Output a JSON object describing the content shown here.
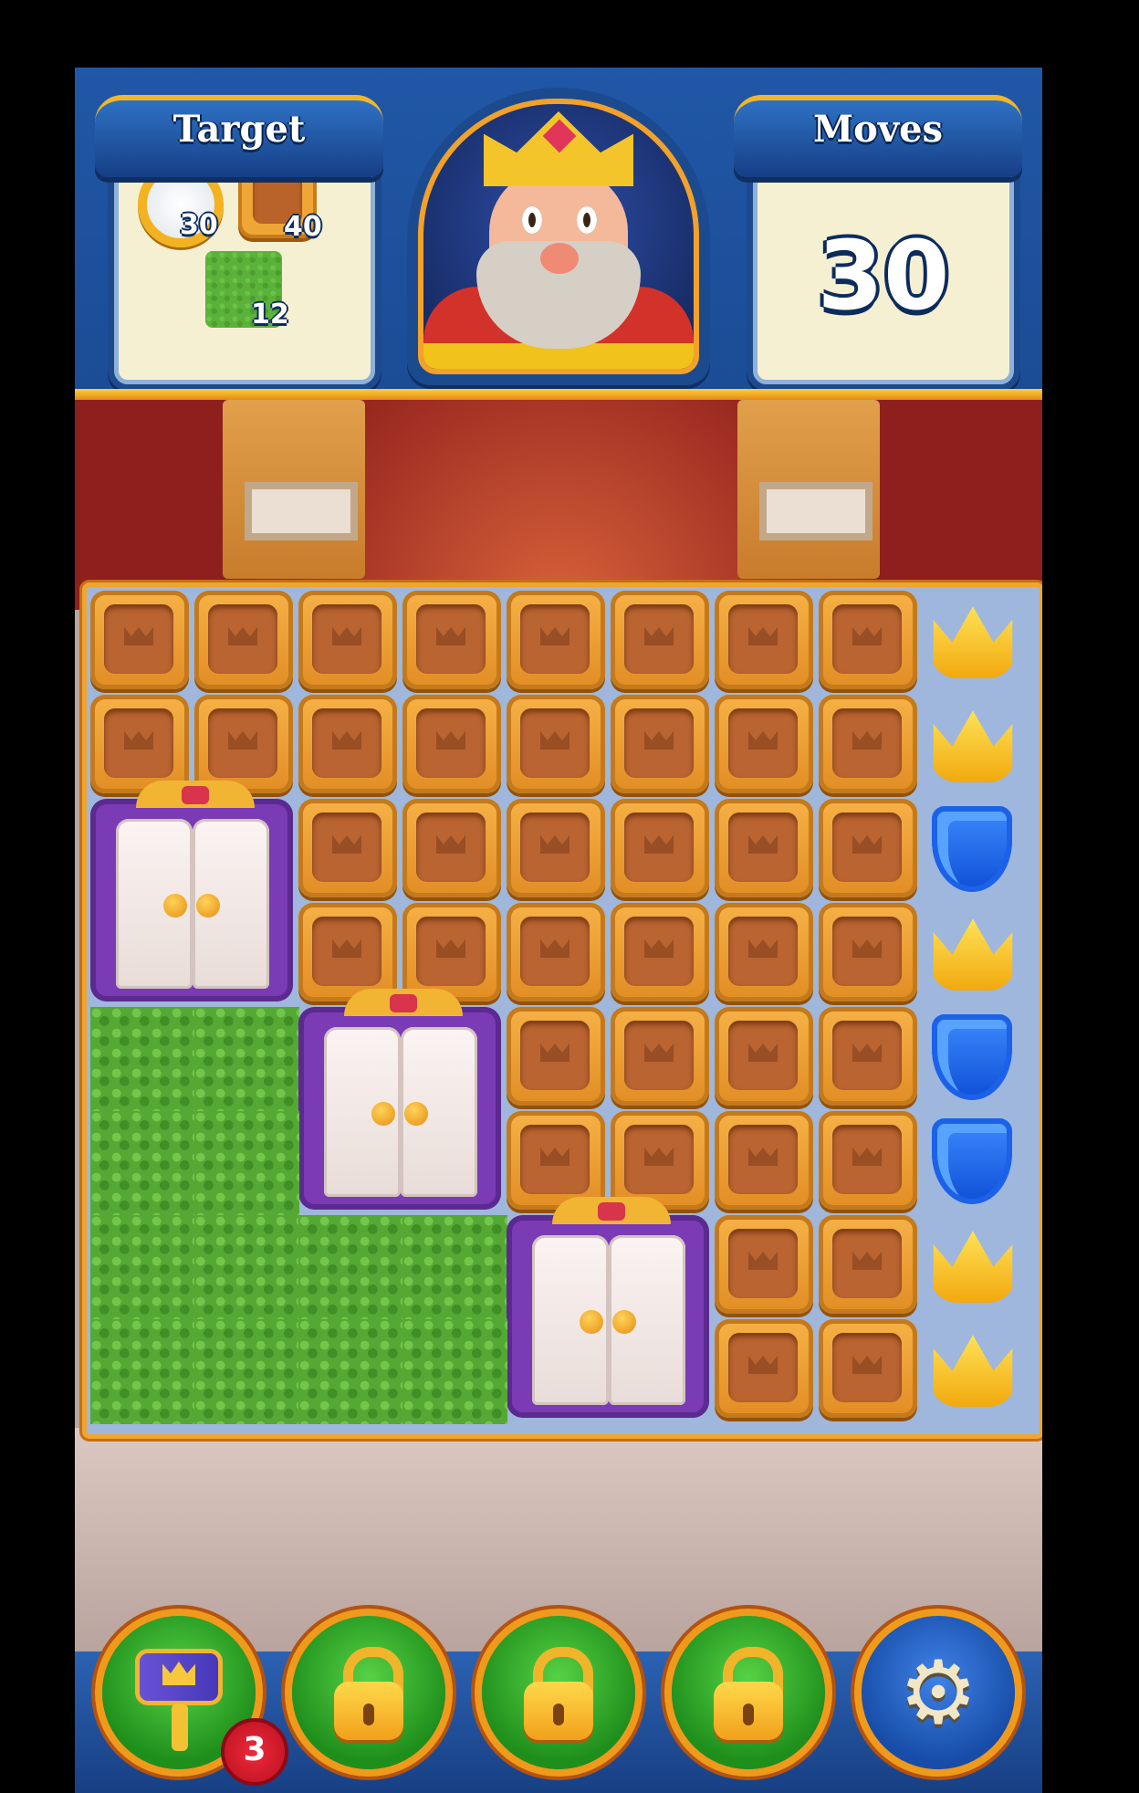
{
  "header": {
    "target_title": "Target",
    "moves_title": "Moves",
    "moves_value": "30"
  },
  "targets": [
    {
      "icon": "ring-icon",
      "count": "30"
    },
    {
      "icon": "crate-icon",
      "count": "40"
    },
    {
      "icon": "grass-icon",
      "count": "12"
    }
  ],
  "board": {
    "cols": 9,
    "rows": 8,
    "grid": [
      [
        "crate",
        "crate",
        "crate",
        "crate",
        "crate",
        "crate",
        "crate",
        "crate",
        "crown"
      ],
      [
        "crate",
        "crate",
        "crate",
        "crate",
        "crate",
        "crate",
        "crate",
        "crate",
        "crown"
      ],
      [
        "door",
        "door",
        "crate",
        "crate",
        "crate",
        "crate",
        "crate",
        "crate",
        "shield"
      ],
      [
        "door",
        "door",
        "crate",
        "crate",
        "crate",
        "crate",
        "crate",
        "crate",
        "crown"
      ],
      [
        "grass",
        "grass",
        "door",
        "door",
        "crate",
        "crate",
        "crate",
        "crate",
        "shield"
      ],
      [
        "grass",
        "grass",
        "door",
        "door",
        "crate",
        "crate",
        "crate",
        "crate",
        "shield"
      ],
      [
        "grass",
        "grass",
        "grass",
        "grass",
        "door",
        "door",
        "crate",
        "crate",
        "crown"
      ],
      [
        "grass",
        "grass",
        "grass",
        "grass",
        "door",
        "door",
        "crate",
        "crate",
        "crown"
      ]
    ]
  },
  "boosters": [
    {
      "name": "hammer",
      "icon": "hammer-icon",
      "locked": false,
      "count": "3"
    },
    {
      "name": "locked-1",
      "icon": "lock-icon",
      "locked": true
    },
    {
      "name": "locked-2",
      "icon": "lock-icon",
      "locked": true
    },
    {
      "name": "locked-3",
      "icon": "lock-icon",
      "locked": true
    },
    {
      "name": "settings",
      "icon": "gear-icon"
    }
  ],
  "colors": {
    "header_blue": "#1b4c95",
    "gold": "#f0a52d",
    "crate": "#e89a2f",
    "grass": "#54a834",
    "door_frame": "#7a3bb5",
    "shield": "#1e5ff0",
    "crown": "#f6c21c"
  }
}
